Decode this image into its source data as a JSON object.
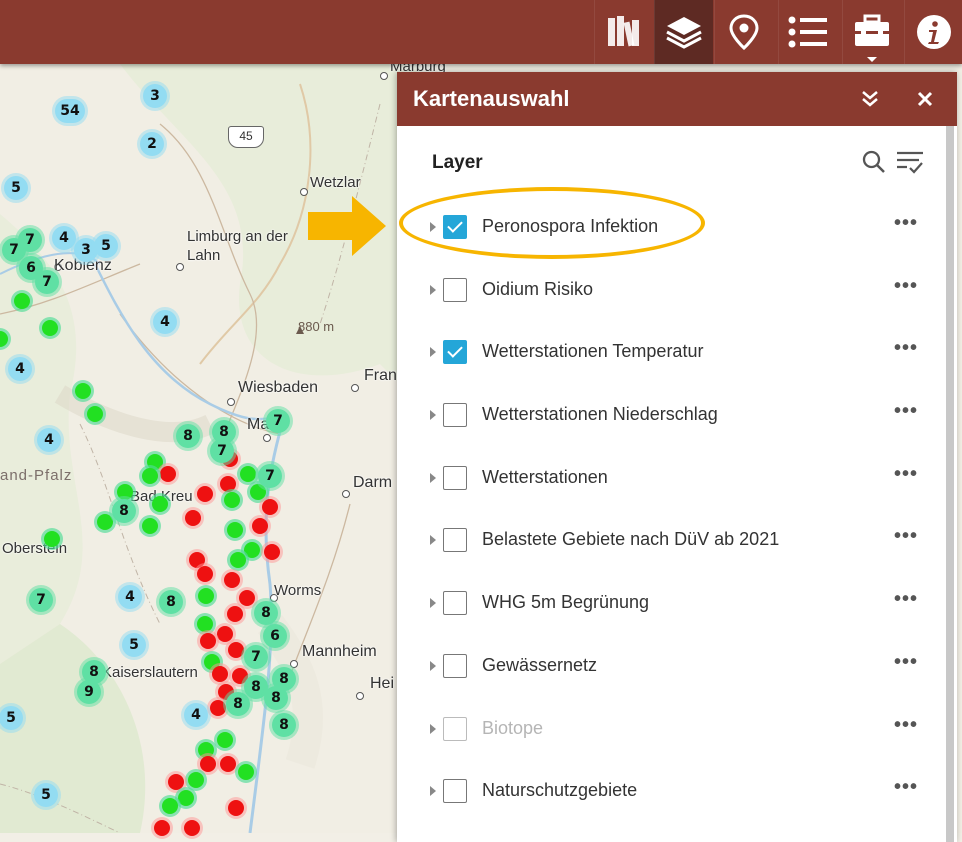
{
  "topbar": {
    "tools": [
      {
        "name": "bookmarks-icon",
        "active": false
      },
      {
        "name": "layers-icon",
        "active": true
      },
      {
        "name": "location-pin-icon",
        "active": false
      },
      {
        "name": "legend-list-icon",
        "active": false
      },
      {
        "name": "toolbox-icon",
        "active": false
      },
      {
        "name": "info-icon",
        "active": false
      }
    ]
  },
  "colors": {
    "brand": "#8a3a2f",
    "brand_dark": "#5e2a23",
    "checkbox": "#24a6d8",
    "highlight": "#f7b500",
    "cluster_blue": "#93dcf2",
    "cluster_teal": "#5fe0a4",
    "pin_green": "#22e022",
    "pin_red": "#ee1111"
  },
  "map": {
    "cities": {
      "marburg": "Marburg",
      "wetzlar": "Wetzlar",
      "limburg": "Limburg an der Lahn",
      "koblenz": "Koblenz",
      "wiesbaden": "Wiesbaden",
      "frankfurt": "Fran",
      "mainz": "Ma",
      "darmstadt": "Darm",
      "badkreuznach": "Bad Kreu",
      "oberstein": "Oberstein",
      "worms": "Worms",
      "mannheim": "Mannheim",
      "heidelberg": "Hei",
      "kaiserslautern": "Kaiserslautern"
    },
    "region_label": "and-Pfalz",
    "elevation_label": "880 m",
    "road_label": "45",
    "clusters_blue": [
      "54",
      "3",
      "2",
      "5",
      "4",
      "3",
      "5",
      "4",
      "4",
      "4",
      "4",
      "5",
      "4",
      "5",
      "5"
    ],
    "clusters_teal": [
      "7",
      "7",
      "6",
      "7",
      "8",
      "8",
      "7",
      "7",
      "7",
      "8",
      "7",
      "8",
      "8",
      "6",
      "7",
      "8",
      "9",
      "8",
      "8",
      "8",
      "8",
      "8"
    ]
  },
  "panel": {
    "title": "Kartenauswahl",
    "collapse_icon": "double-chevron-down-icon",
    "close_icon": "close-icon",
    "heading": "Layer",
    "search_icon": "search-icon",
    "filter_icon": "filter-list-icon",
    "layers": [
      {
        "label": "Peronospora Infektion",
        "checked": true,
        "enabled": true
      },
      {
        "label": "Oidium Risiko",
        "checked": false,
        "enabled": true
      },
      {
        "label": "Wetterstationen Temperatur",
        "checked": true,
        "enabled": true
      },
      {
        "label": "Wetterstationen Niederschlag",
        "checked": false,
        "enabled": true
      },
      {
        "label": "Wetterstationen",
        "checked": false,
        "enabled": true
      },
      {
        "label": "Belastete Gebiete nach DüV ab 2021",
        "checked": false,
        "enabled": true
      },
      {
        "label": "WHG 5m Begrünung",
        "checked": false,
        "enabled": true
      },
      {
        "label": "Gewässernetz",
        "checked": false,
        "enabled": true
      },
      {
        "label": "Biotope",
        "checked": false,
        "enabled": false
      },
      {
        "label": "Naturschutzgebiete",
        "checked": false,
        "enabled": true
      }
    ],
    "more_label": "•••"
  }
}
